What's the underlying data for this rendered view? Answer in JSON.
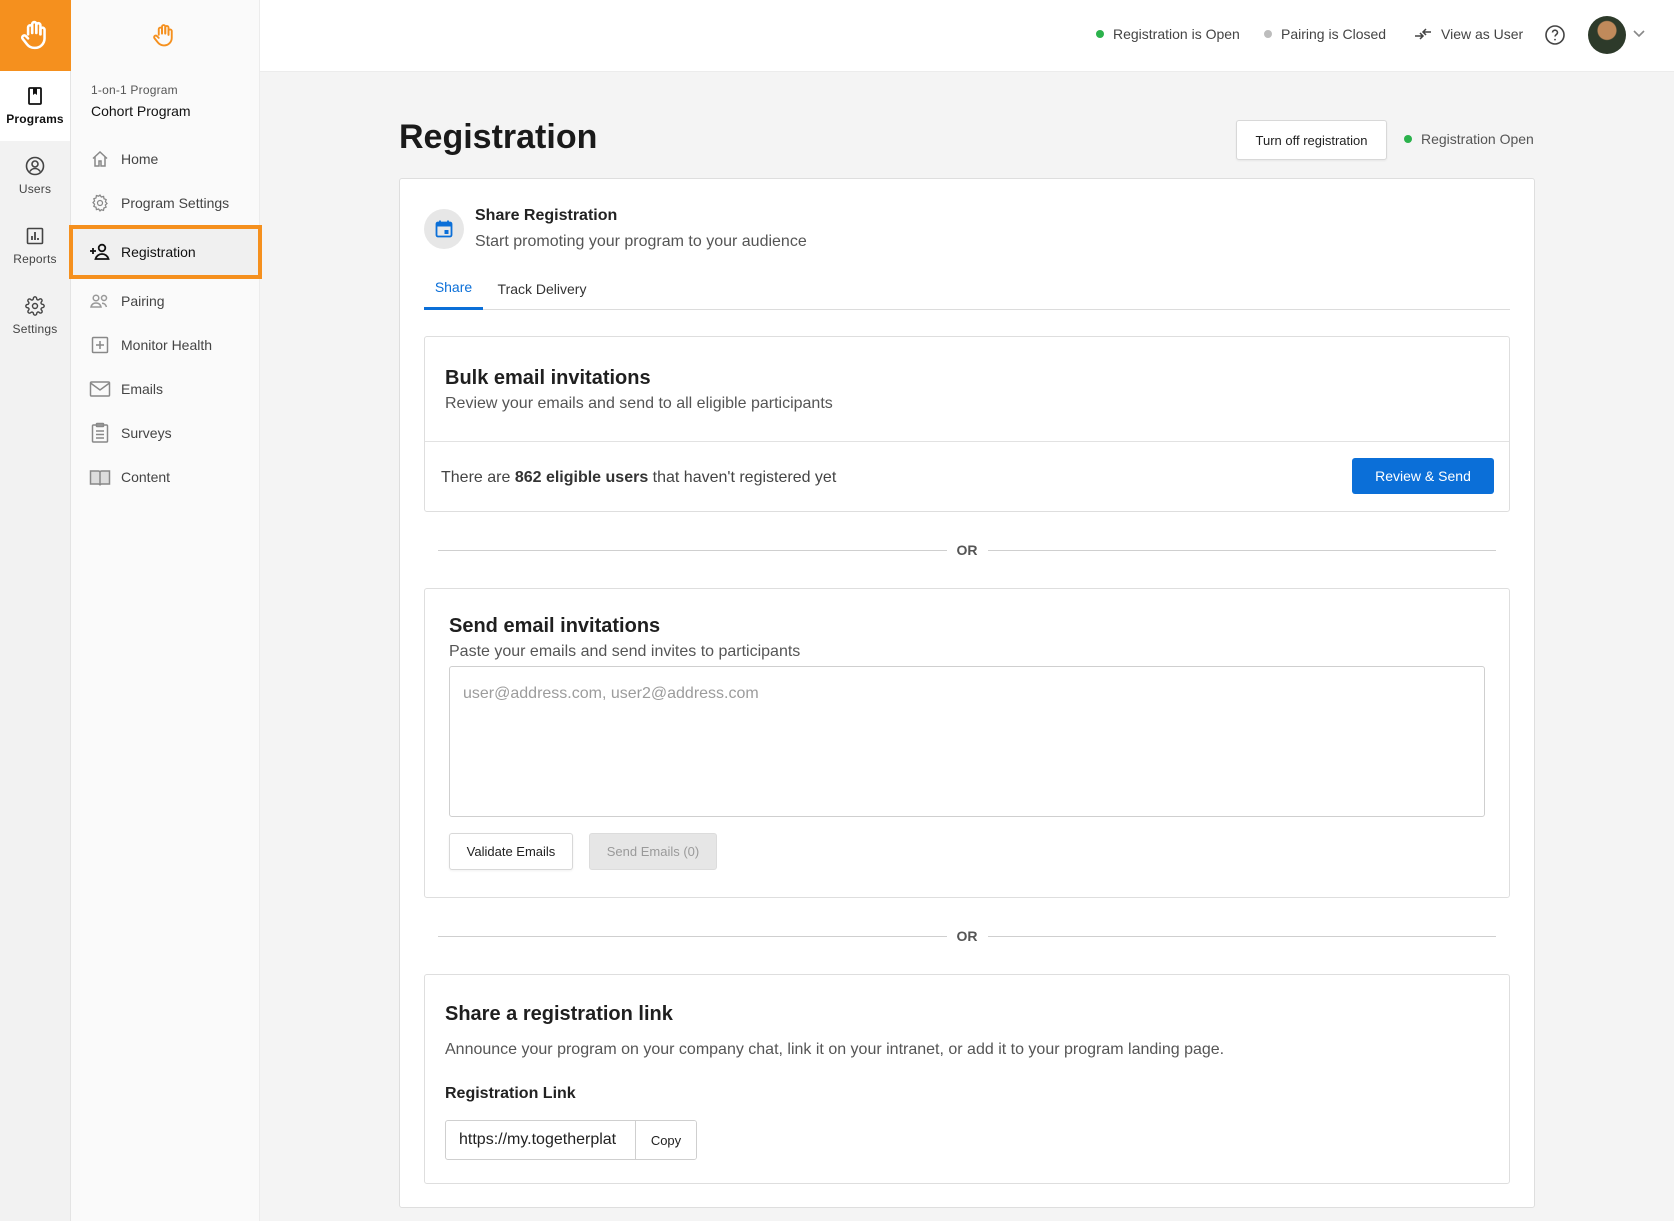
{
  "rail": {
    "items": [
      {
        "label": "Programs",
        "icon": "book-icon",
        "active": true
      },
      {
        "label": "Users",
        "icon": "user-circle-icon",
        "active": false
      },
      {
        "label": "Reports",
        "icon": "bar-chart-icon",
        "active": false
      },
      {
        "label": "Settings",
        "icon": "gear-icon",
        "active": false
      }
    ]
  },
  "sidebar": {
    "program_type": "1-on-1 Program",
    "program_name": "Cohort Program",
    "items": [
      {
        "label": "Home",
        "icon": "home-icon"
      },
      {
        "label": "Program Settings",
        "icon": "gear-icon"
      },
      {
        "label": "Registration",
        "icon": "add-person-icon",
        "active": true
      },
      {
        "label": "Pairing",
        "icon": "people-icon"
      },
      {
        "label": "Monitor Health",
        "icon": "plus-square-icon"
      },
      {
        "label": "Emails",
        "icon": "envelope-icon"
      },
      {
        "label": "Surveys",
        "icon": "clipboard-icon"
      },
      {
        "label": "Content",
        "icon": "open-book-icon"
      }
    ]
  },
  "topbar": {
    "registration_status": "Registration is Open",
    "pairing_status": "Pairing is Closed",
    "view_as_user": "View as User"
  },
  "page": {
    "title": "Registration",
    "turn_off_label": "Turn off registration",
    "status_label": "Registration Open"
  },
  "share": {
    "title": "Share Registration",
    "subtitle": "Start promoting your program to your audience",
    "tabs": [
      "Share",
      "Track Delivery"
    ]
  },
  "bulk": {
    "title": "Bulk email invitations",
    "description": "Review your emails and send to all eligible participants",
    "text_before": "There are ",
    "count_text": "862 eligible users",
    "text_after": " that haven't registered yet",
    "button": "Review & Send"
  },
  "or_label": "OR",
  "send": {
    "title": "Send email invitations",
    "description": "Paste your emails and send invites to participants",
    "placeholder": "user@address.com, user2@address.com",
    "validate_button": "Validate Emails",
    "send_button": "Send Emails (0)"
  },
  "link": {
    "title": "Share a registration link",
    "description": "Announce your program on your company chat, link it on your intranet, or add it to your program landing page.",
    "label": "Registration Link",
    "url": "https://my.togetherplat",
    "copy_button": "Copy"
  },
  "colors": {
    "brand_orange": "#f5901e",
    "primary_blue": "#0b6fd8",
    "status_green": "#2bb24c",
    "status_grey": "#bdbdbd"
  }
}
